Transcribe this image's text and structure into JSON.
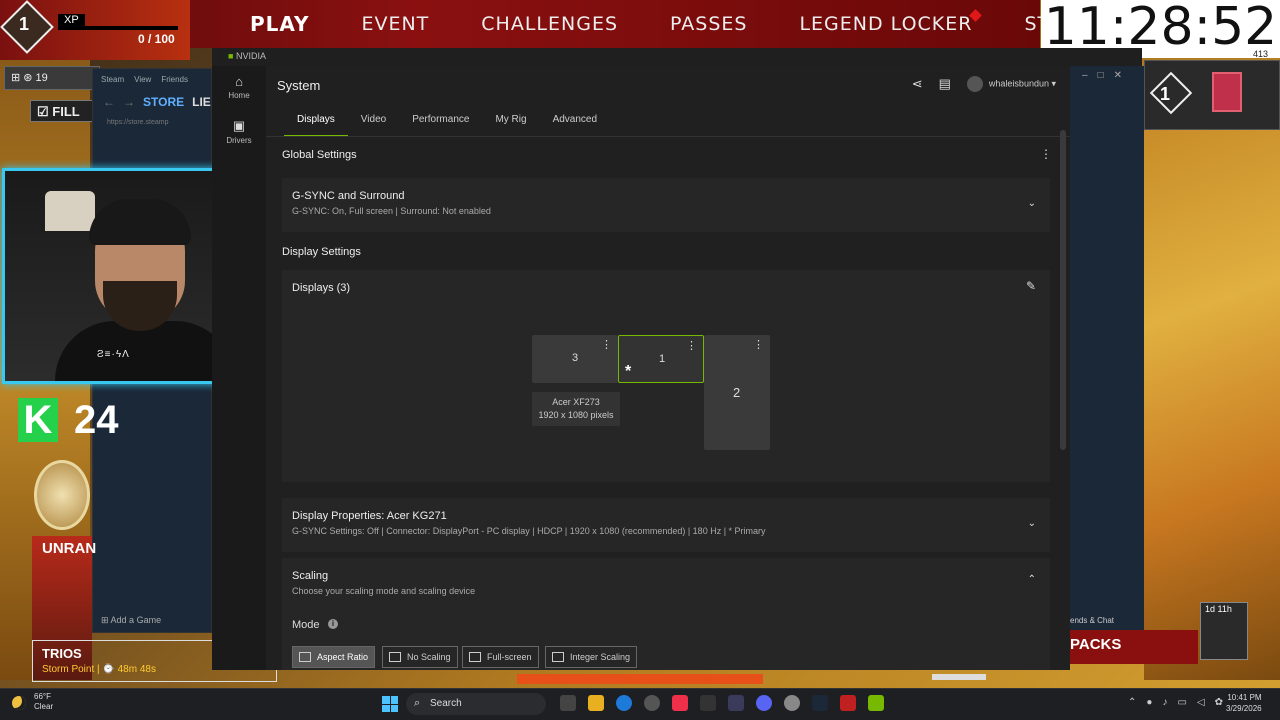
{
  "game": {
    "level": "1",
    "xp_label": "XP",
    "xp_count": "0 / 100",
    "nav": [
      "PLAY",
      "EVENT",
      "CHALLENGES",
      "PASSES",
      "LEGEND LOCKER",
      "STORE"
    ],
    "fill_label": "FILL",
    "kills": "24",
    "ranked_title": "UNRAN",
    "mode": "TRIOS",
    "map_timer": "Storm Point | ⌚ 48m 48s",
    "right_level": "1",
    "packs_label": "PACKS",
    "packs_timer": "1d 11h",
    "friends_chat": "ends & Chat"
  },
  "clock": {
    "time": "11:28:52",
    "sub": "413"
  },
  "steam": {
    "menu": [
      "Steam",
      "View",
      "Friends"
    ],
    "store": "STORE",
    "library": "LIE",
    "url": "https://store.steamp",
    "add_game": "Add a Game"
  },
  "nvidia": {
    "window_title": "NVIDIA",
    "sidebar": [
      {
        "label": "Home",
        "icon": "home-icon"
      },
      {
        "label": "Drivers",
        "icon": "drivers-icon"
      }
    ],
    "page_title": "System",
    "username": "whaleisbundun",
    "tabs": [
      "Displays",
      "Video",
      "Performance",
      "My Rig",
      "Advanced"
    ],
    "global_settings": "Global Settings",
    "gsync_title": "G-SYNC and Surround",
    "gsync_sub": "G-SYNC: On, Full screen | Surround: Not enabled",
    "display_settings": "Display Settings",
    "displays_count": "Displays (3)",
    "display_boxes": [
      {
        "label": "3"
      },
      {
        "label": "1",
        "primary_mark": "*"
      },
      {
        "label": "2"
      }
    ],
    "tooltip_name": "Acer XF273",
    "tooltip_res": "1920 x 1080 pixels",
    "props_title": "Display Properties: Acer KG271",
    "props_sub": "G-SYNC Settings: Off | Connector: DisplayPort - PC display | HDCP | 1920 x 1080 (recommended) | 180 Hz | * Primary",
    "scaling_title": "Scaling",
    "scaling_sub": "Choose your scaling mode and scaling device",
    "mode_label": "Mode",
    "mode_buttons": [
      "Aspect Ratio",
      "No Scaling",
      "Full-screen",
      "Integer Scaling"
    ],
    "accent": "#76b900"
  },
  "taskbar": {
    "temp": "66°F",
    "condition": "Clear",
    "search": "Search",
    "time": "10:41 PM",
    "date": "3/29/2026"
  }
}
